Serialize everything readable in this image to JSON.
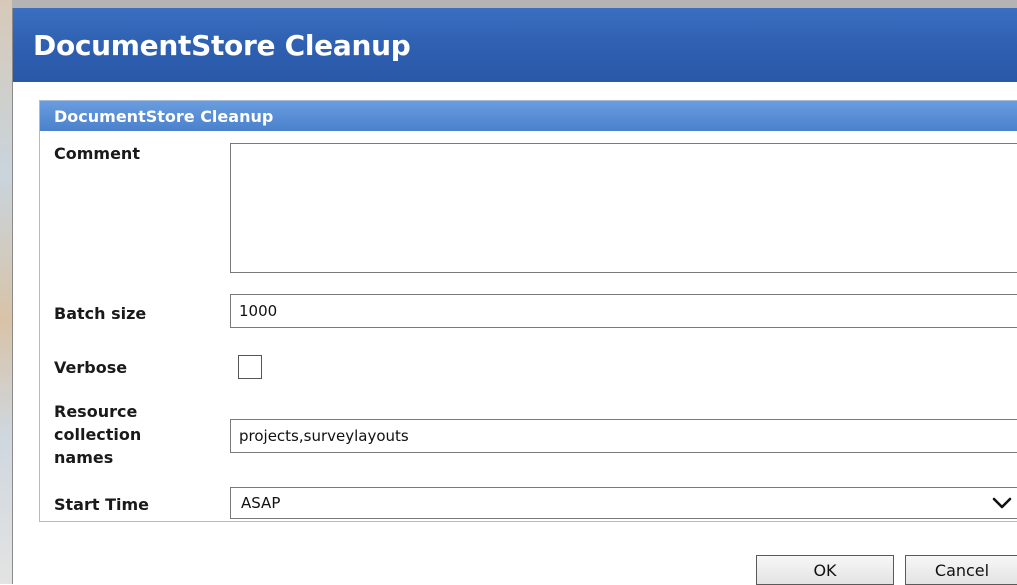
{
  "dialog": {
    "title": "DocumentStore Cleanup"
  },
  "panel": {
    "title": "DocumentStore Cleanup"
  },
  "form": {
    "comment_label": "Comment",
    "comment_value": "",
    "batch_size_label": "Batch size",
    "batch_size_value": "1000",
    "verbose_label": "Verbose",
    "verbose_checked": false,
    "resource_label_line1": "Resource",
    "resource_label_line2": "collection",
    "resource_label_line3": "names",
    "resource_value": "projects,surveylayouts",
    "start_time_label": "Start Time",
    "start_time_value": "ASAP"
  },
  "buttons": {
    "ok_label": "OK",
    "cancel_label": "Cancel"
  },
  "colors": {
    "title_bar": "#2e5fb0",
    "panel_header": "#5a8dd6"
  }
}
